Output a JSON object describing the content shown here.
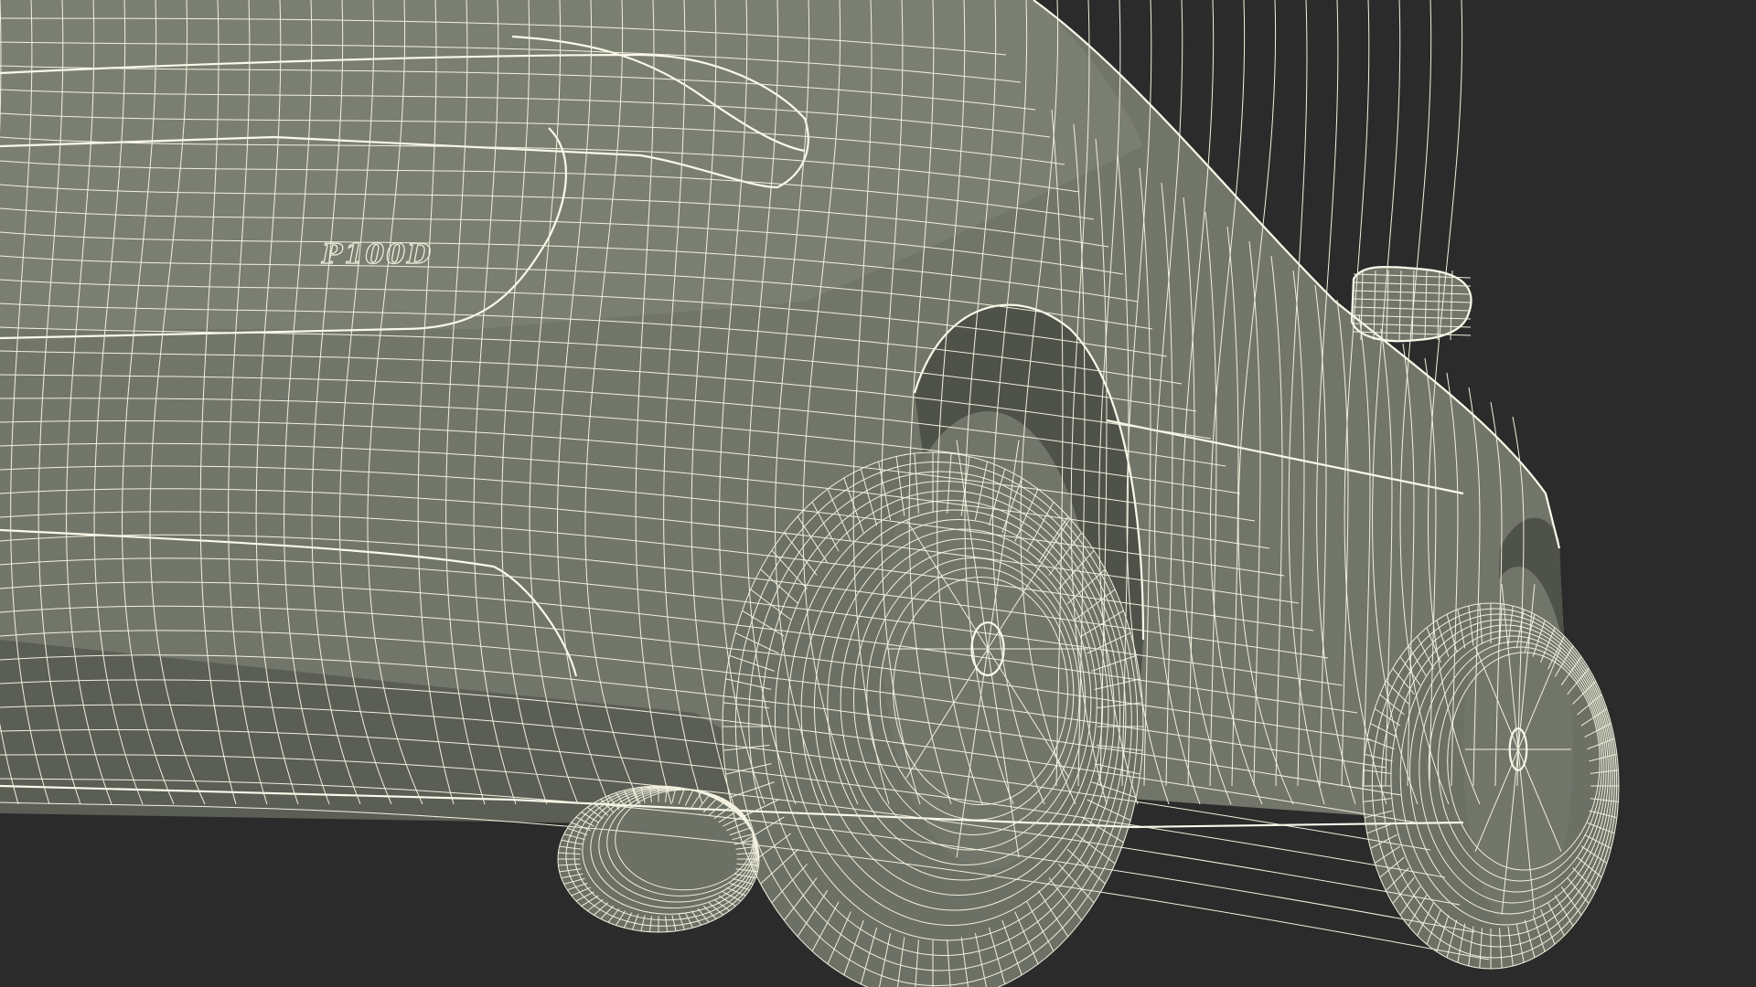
{
  "viewport": {
    "background_color": "#2b2b2b",
    "mesh_color": "#72766a",
    "wire_color": "#f2f0df"
  },
  "badge": {
    "text": "P100D"
  }
}
